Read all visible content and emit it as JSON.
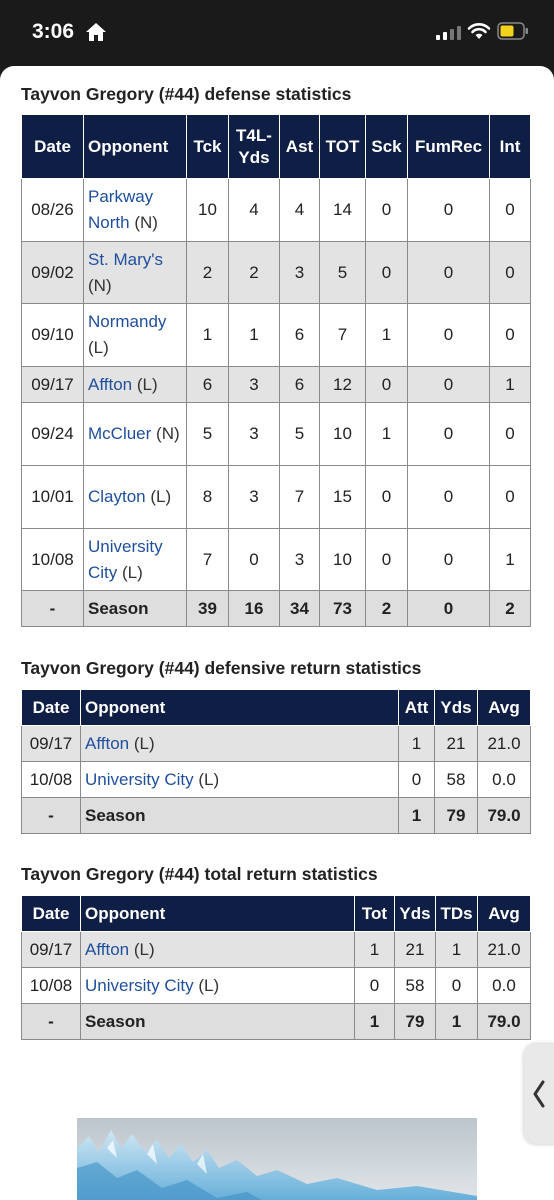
{
  "status_bar": {
    "time": "3:06"
  },
  "section1": {
    "title": "Tayvon Gregory (#44) defense statistics",
    "headers": [
      "Date",
      "Opponent",
      "Tck",
      "T4L-Yds",
      "Ast",
      "TOT",
      "Sck",
      "FumRec",
      "Int"
    ],
    "rows": [
      {
        "date": "08/26",
        "opp": "Parkway North",
        "tag": "(N)",
        "tck": "10",
        "t4l": "4",
        "ast": "4",
        "tot": "14",
        "sck": "0",
        "fum": "0",
        "int": "0"
      },
      {
        "date": "09/02",
        "opp": "St. Mary's",
        "tag": "(N)",
        "tck": "2",
        "t4l": "2",
        "ast": "3",
        "tot": "5",
        "sck": "0",
        "fum": "0",
        "int": "0"
      },
      {
        "date": "09/10",
        "opp": "Normandy",
        "tag": "(L)",
        "tck": "1",
        "t4l": "1",
        "ast": "6",
        "tot": "7",
        "sck": "1",
        "fum": "0",
        "int": "0"
      },
      {
        "date": "09/17",
        "opp": "Affton",
        "tag": "(L)",
        "tck": "6",
        "t4l": "3",
        "ast": "6",
        "tot": "12",
        "sck": "0",
        "fum": "0",
        "int": "1"
      },
      {
        "date": "09/24",
        "opp": "McCluer",
        "tag": "(N)",
        "tck": "5",
        "t4l": "3",
        "ast": "5",
        "tot": "10",
        "sck": "1",
        "fum": "0",
        "int": "0"
      },
      {
        "date": "10/01",
        "opp": "Clayton",
        "tag": "(L)",
        "tck": "8",
        "t4l": "3",
        "ast": "7",
        "tot": "15",
        "sck": "0",
        "fum": "0",
        "int": "0"
      },
      {
        "date": "10/08",
        "opp": "University City",
        "tag": "(L)",
        "tck": "7",
        "t4l": "0",
        "ast": "3",
        "tot": "10",
        "sck": "0",
        "fum": "0",
        "int": "1"
      }
    ],
    "total": {
      "date": "-",
      "opp": "Season",
      "tck": "39",
      "t4l": "16",
      "ast": "34",
      "tot": "73",
      "sck": "2",
      "fum": "0",
      "int": "2"
    }
  },
  "section2": {
    "title": "Tayvon Gregory (#44) defensive return statistics",
    "headers": [
      "Date",
      "Opponent",
      "Att",
      "Yds",
      "Avg"
    ],
    "rows": [
      {
        "date": "09/17",
        "opp": "Affton",
        "tag": "(L)",
        "a": "1",
        "b": "21",
        "c": "21.0"
      },
      {
        "date": "10/08",
        "opp": "University City",
        "tag": "(L)",
        "a": "0",
        "b": "58",
        "c": "0.0"
      }
    ],
    "total": {
      "date": "-",
      "opp": "Season",
      "a": "1",
      "b": "79",
      "c": "79.0"
    }
  },
  "section3": {
    "title": "Tayvon Gregory (#44) total return statistics",
    "headers": [
      "Date",
      "Opponent",
      "Tot",
      "Yds",
      "TDs",
      "Avg"
    ],
    "rows": [
      {
        "date": "09/17",
        "opp": "Affton",
        "tag": "(L)",
        "a": "1",
        "b": "21",
        "c": "1",
        "d": "21.0"
      },
      {
        "date": "10/08",
        "opp": "University City",
        "tag": "(L)",
        "a": "0",
        "b": "58",
        "c": "0",
        "d": "0.0"
      }
    ],
    "total": {
      "date": "-",
      "opp": "Season",
      "a": "1",
      "b": "79",
      "c": "1",
      "d": "79.0"
    }
  },
  "colors": {
    "header_bg": "#0f1e45",
    "link": "#1f4f9c",
    "row_alt": "#e3e3e3"
  }
}
